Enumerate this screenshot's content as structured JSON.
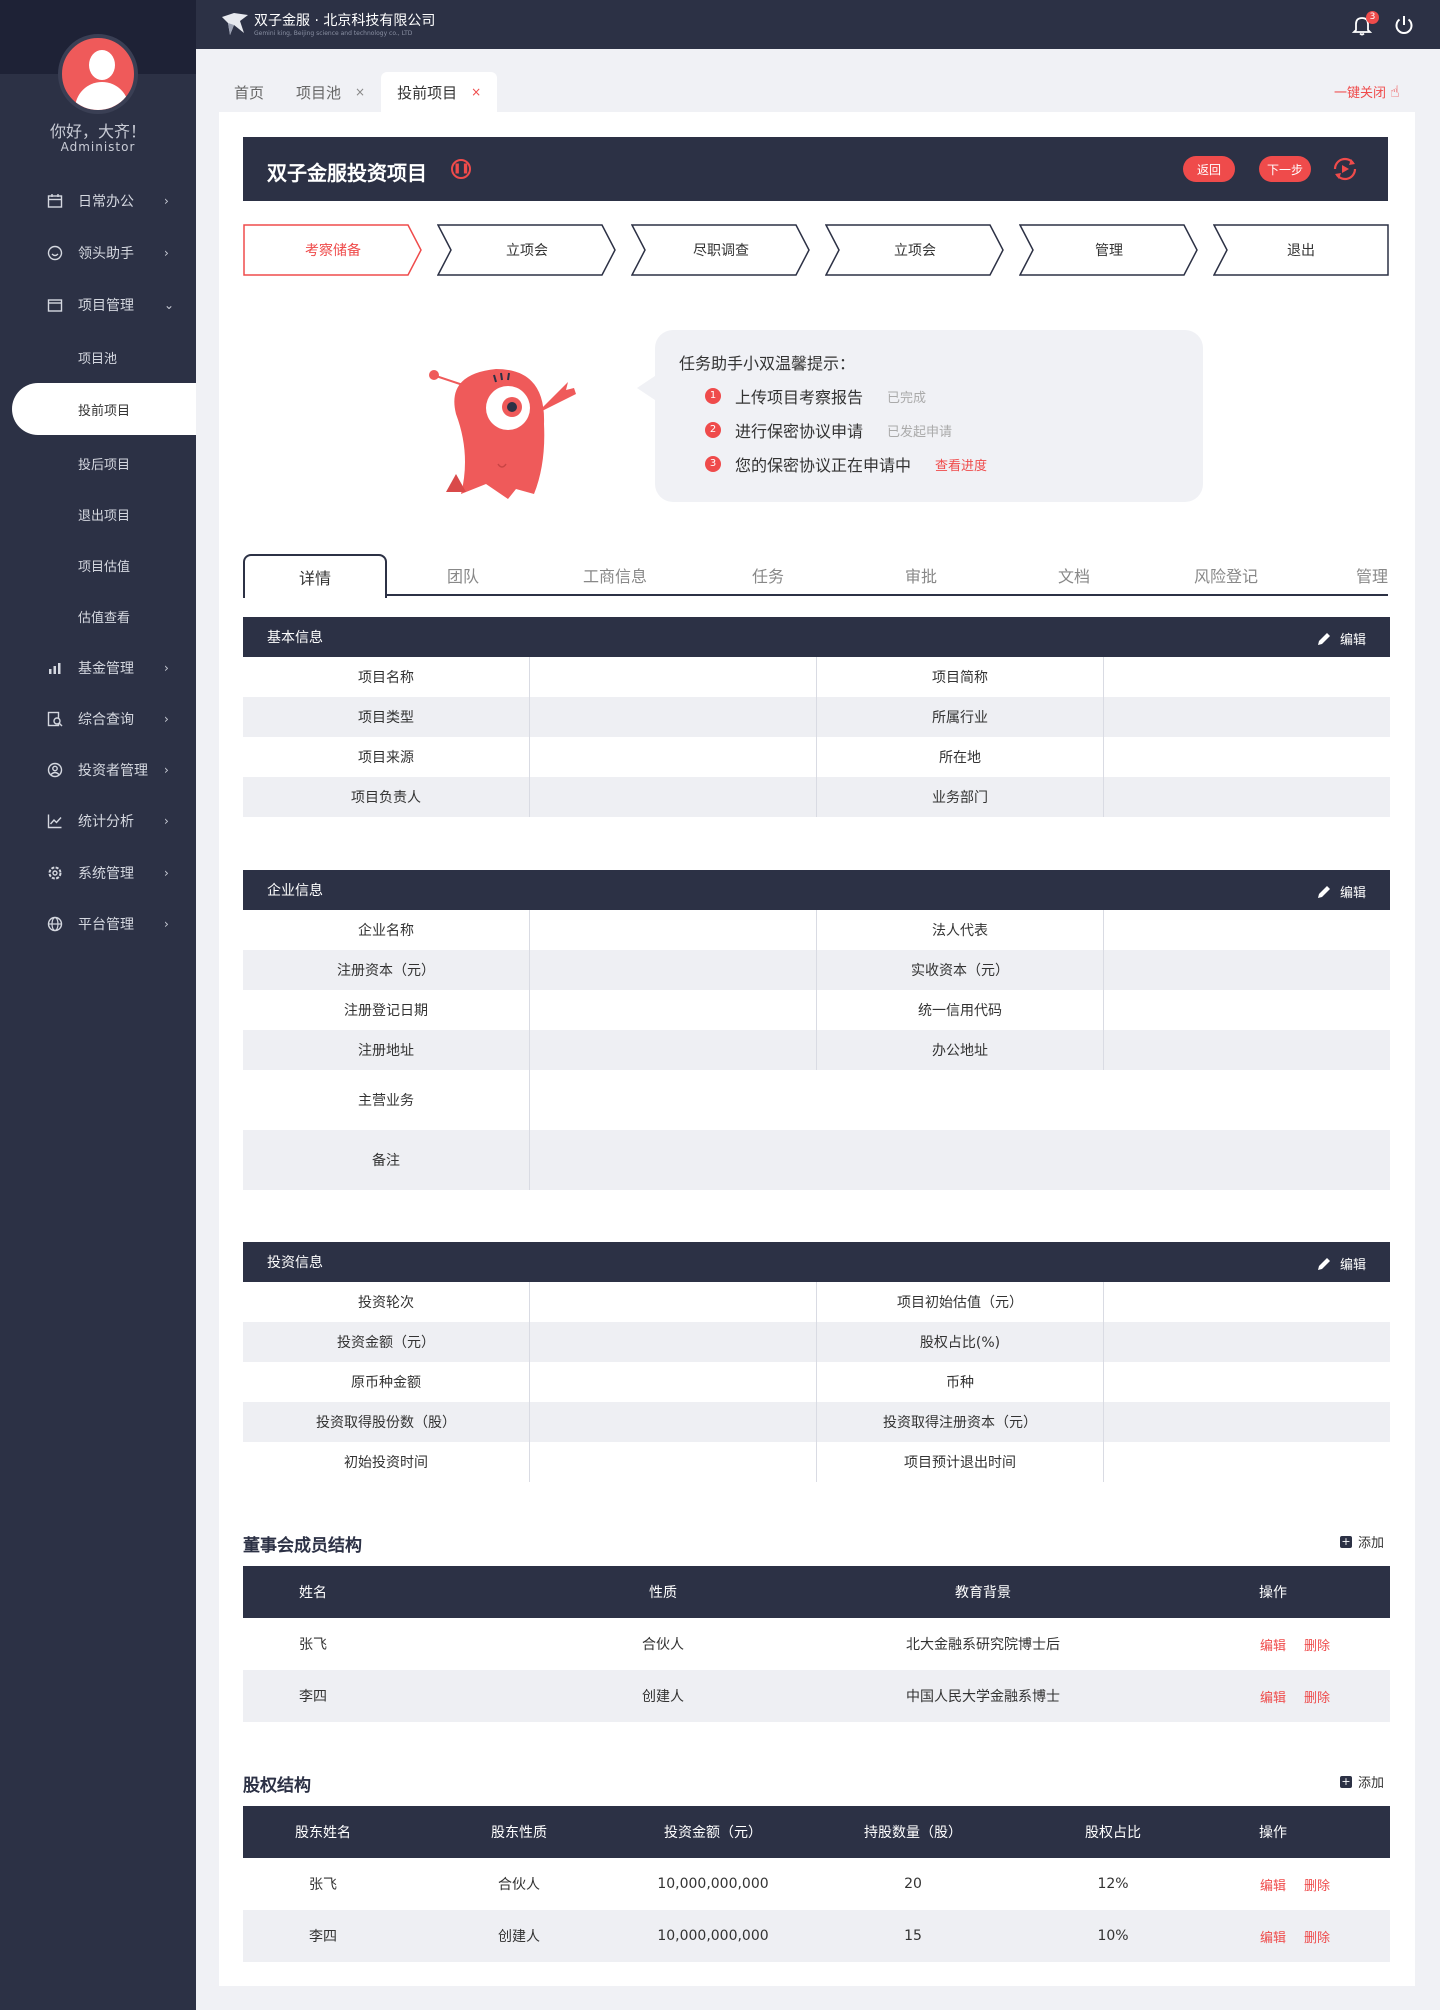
{
  "user": {
    "greeting": "你好，大齐！",
    "role": "Administor"
  },
  "brand": {
    "name": "双子金服 · 北京科技有限公司",
    "tagline": "Gemini king, Beijing science and technology co., LTD",
    "accent": "#ef4b4b",
    "dark": "#2c3145"
  },
  "header": {
    "notification_count": "3"
  },
  "sidebar": {
    "items": [
      {
        "label": "日常办公",
        "icon": "calendar-icon"
      },
      {
        "label": "领头助手",
        "icon": "chat-icon"
      },
      {
        "label": "项目管理",
        "icon": "folder-icon"
      },
      {
        "label": "基金管理",
        "icon": "bar-chart-icon"
      },
      {
        "label": "综合查询",
        "icon": "search-doc-icon"
      },
      {
        "label": "投资者管理",
        "icon": "user-circle-icon"
      },
      {
        "label": "统计分析",
        "icon": "line-chart-icon"
      },
      {
        "label": "系统管理",
        "icon": "gear-icon"
      },
      {
        "label": "平台管理",
        "icon": "globe-icon"
      }
    ],
    "sub_items": [
      "项目池",
      "投前项目",
      "投后项目",
      "退出项目",
      "项目估值",
      "估值查看"
    ]
  },
  "page_tabs": [
    {
      "label": "首页"
    },
    {
      "label": "项目池"
    },
    {
      "label": "投前项目"
    }
  ],
  "close_all": "一键关闭",
  "project": {
    "title": "双子金服投资项目",
    "back": "返回",
    "next": "下一步"
  },
  "steps": [
    "考察储备",
    "立项会",
    "尽职调查",
    "立项会",
    "管理",
    "退出"
  ],
  "tips": {
    "title": "任务助手小双温馨提示：",
    "items": [
      {
        "num": "1",
        "text": "上传项目考察报告",
        "status": "已完成"
      },
      {
        "num": "2",
        "text": "进行保密协议申请",
        "status": "已发起申请"
      },
      {
        "num": "3",
        "text": "您的保密协议正在申请中",
        "link": "查看进度"
      }
    ]
  },
  "detail_tabs": [
    "详情",
    "团队",
    "工商信息",
    "任务",
    "审批",
    "文档",
    "风险登记",
    "管理"
  ],
  "edit_label": "编辑",
  "basic_info": {
    "title": "基本信息",
    "rows": [
      [
        "项目名称",
        "项目简称"
      ],
      [
        "项目类型",
        "所属行业"
      ],
      [
        "项目来源",
        "所在地"
      ],
      [
        "项目负责人",
        "业务部门"
      ]
    ]
  },
  "company_info": {
    "title": "企业信息",
    "rows": [
      [
        "企业名称",
        "法人代表"
      ],
      [
        "注册资本（元）",
        "实收资本（元）"
      ],
      [
        "注册登记日期",
        "统一信用代码"
      ],
      [
        "注册地址",
        "办公地址"
      ]
    ],
    "wide": [
      "主营业务",
      "备注"
    ]
  },
  "invest_info": {
    "title": "投资信息",
    "rows": [
      [
        "投资轮次",
        "项目初始估值（元）"
      ],
      [
        "投资金额（元）",
        "股权占比(%)"
      ],
      [
        "原币种金额",
        "币种"
      ],
      [
        "投资取得股份数（股）",
        "投资取得注册资本（元）"
      ],
      [
        "初始投资时间",
        "项目预计退出时间"
      ]
    ]
  },
  "add_label": "添加",
  "board": {
    "title": "董事会成员结构",
    "headers": [
      "姓名",
      "性质",
      "教育背景",
      "操作"
    ],
    "rows": [
      {
        "name": "张飞",
        "type": "合伙人",
        "edu": "北大金融系研究院博士后"
      },
      {
        "name": "李四",
        "type": "创建人",
        "edu": "中国人民大学金融系博士"
      }
    ]
  },
  "equity": {
    "title": "股权结构",
    "headers": [
      "股东姓名",
      "股东性质",
      "投资金额（元）",
      "持股数量（股）",
      "股权占比",
      "操作"
    ],
    "rows": [
      {
        "name": "张飞",
        "type": "合伙人",
        "amount": "10,000,000,000",
        "shares": "20",
        "pct": "12%"
      },
      {
        "name": "李四",
        "type": "创建人",
        "amount": "10,000,000,000",
        "shares": "15",
        "pct": "10%"
      }
    ]
  },
  "ops": {
    "edit": "编辑",
    "delete": "删除"
  }
}
